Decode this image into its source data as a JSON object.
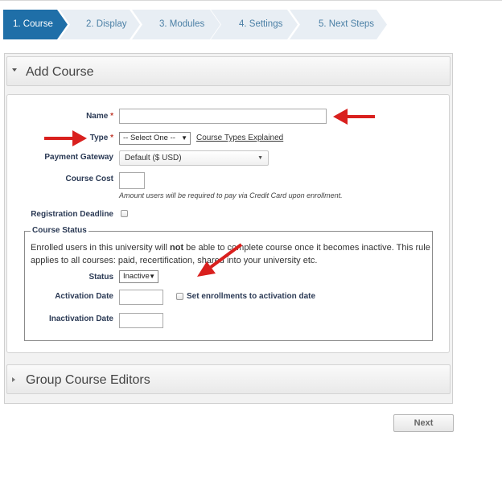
{
  "wizard": {
    "steps": [
      {
        "label": "1. Course",
        "active": true
      },
      {
        "label": "2. Display",
        "active": false
      },
      {
        "label": "3. Modules",
        "active": false
      },
      {
        "label": "4. Settings",
        "active": false
      },
      {
        "label": "5. Next Steps",
        "active": false
      }
    ]
  },
  "add_course": {
    "title": "Add Course",
    "name": {
      "label": "Name",
      "required_mark": "*",
      "value": ""
    },
    "type": {
      "label": "Type",
      "required_mark": "*",
      "selected": "-- Select One --",
      "link": "Course Types Explained"
    },
    "payment_gateway": {
      "label": "Payment Gateway",
      "selected": "Default ($ USD)"
    },
    "course_cost": {
      "label": "Course Cost",
      "value": "",
      "hint": "Amount users will be required to pay via Credit Card upon enrollment."
    },
    "registration_deadline": {
      "label": "Registration Deadline",
      "checked": false
    },
    "course_status": {
      "legend": "Course Status",
      "text_before": "Enrolled users in this university will ",
      "text_bold": "not",
      "text_after": " be able to complete course once it becomes inactive. This rule applies to all courses: paid, recertification, shared into your university etc.",
      "status": {
        "label": "Status",
        "selected": "Inactive"
      },
      "activation_date": {
        "label": "Activation Date",
        "value": ""
      },
      "set_enrollments": {
        "label": "Set enrollments to activation date",
        "checked": false
      },
      "inactivation_date": {
        "label": "Inactivation Date",
        "value": ""
      }
    }
  },
  "group_course_editors": {
    "title": "Group Course Editors"
  },
  "buttons": {
    "next": "Next"
  },
  "colors": {
    "active_step": "#1f6fa8",
    "inactive_step": "#e8eef4",
    "annotation_arrow": "#d9201e"
  }
}
